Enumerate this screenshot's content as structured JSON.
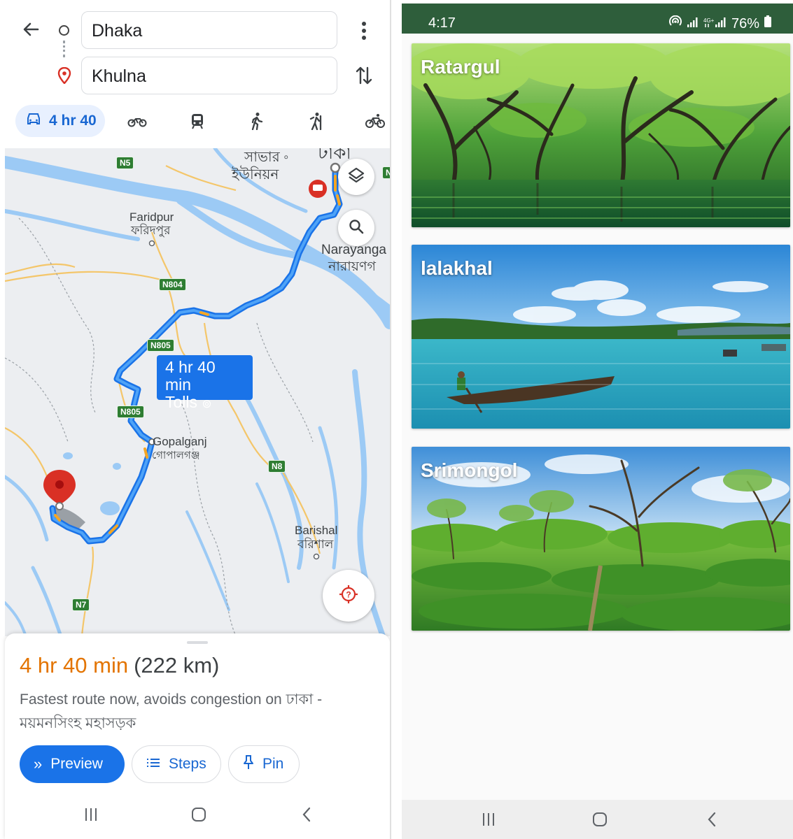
{
  "maps": {
    "origin": "Dhaka",
    "destination": "Khulna",
    "modes": [
      {
        "icon": "car-icon",
        "label": "4 hr 40",
        "selected": true
      },
      {
        "icon": "motorcycle-icon"
      },
      {
        "icon": "transit-icon"
      },
      {
        "icon": "walk-icon"
      },
      {
        "icon": "ride-icon"
      },
      {
        "icon": "bike-icon"
      }
    ],
    "map_labels": {
      "savar": "সাভার",
      "savar_union": "ইউনিয়ন",
      "dhaka_bn": "ঢাকা",
      "faridpur": "Faridpur",
      "faridpur_bn": "ফরিদপুর",
      "narayanganj": "Narayanga",
      "narayanganj_bn": "নারায়ণগ",
      "gopalganj": "Gopalganj",
      "gopalganj_bn": "গোপালগঞ্জ",
      "barishal": "Barishal",
      "barishal_bn": "বরিশাল"
    },
    "road_badges": {
      "n5": "N5",
      "n804": "N804",
      "n805a": "N805",
      "n805b": "N805",
      "n8": "N8",
      "n7": "N7",
      "n_edge": "N"
    },
    "route_callout": {
      "time": "4 hr 40 min",
      "tolls": "Tolls"
    },
    "sheet": {
      "eta": "4 hr 40 min",
      "distance": "(222 km)",
      "description": "Fastest route now, avoids congestion on ঢাকা - ময়মনসিংহ মহাসড়ক",
      "buttons": {
        "preview": "Preview",
        "steps": "Steps",
        "pin": "Pin"
      }
    },
    "colors": {
      "accent": "#1a73e8",
      "eta": "#e37400",
      "route": "#2e8bf0",
      "water": "#9ccaf5",
      "pin": "#d93025"
    }
  },
  "app": {
    "status": {
      "time": "4:17",
      "battery": "76%"
    },
    "places": [
      {
        "name": "Ratargul"
      },
      {
        "name": "lalakhal"
      },
      {
        "name": "Srimongol"
      }
    ],
    "colors": {
      "statusbar": "#2e5e3b"
    }
  }
}
